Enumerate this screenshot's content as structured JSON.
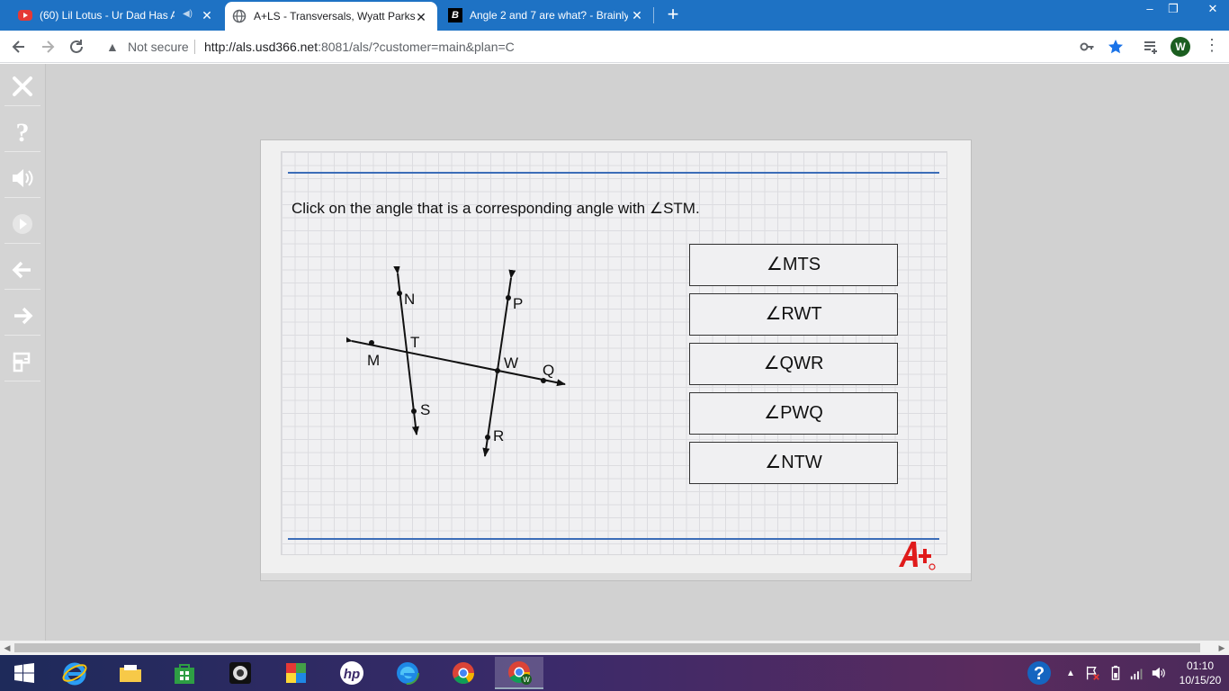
{
  "browser": {
    "tabs": [
      {
        "title": "(60) Lil Lotus - Ur Dad Has A",
        "favicon": "youtube-icon",
        "active": false
      },
      {
        "title": "A+LS - Transversals, Wyatt Parks",
        "favicon": "globe-icon",
        "active": true
      },
      {
        "title": "Angle 2 and 7 are what? - Brainly",
        "favicon": "brainly-icon",
        "active": false
      }
    ],
    "new_tab": "+",
    "security_label": "Not secure",
    "url_host": "http://als.usd366.net",
    "url_rest": ":8081/als/?customer=main&plan=C",
    "profile_initial": "W",
    "window_controls": {
      "minimize": "–",
      "restore": "❐",
      "close": "✕"
    }
  },
  "sidebar": {
    "buttons": [
      "close-icon",
      "help-icon",
      "speaker-icon",
      "play-icon",
      "back-arrow-icon",
      "forward-arrow-icon",
      "tools-icon"
    ]
  },
  "lesson": {
    "prompt": "Click on the angle that is a corresponding angle with ∠STM.",
    "diagram_labels": {
      "N": "N",
      "T": "T",
      "M": "M",
      "S": "S",
      "P": "P",
      "W": "W",
      "Q": "Q",
      "R": "R"
    },
    "answers": [
      "∠MTS",
      "∠RWT",
      "∠QWR",
      "∠PWQ",
      "∠NTW"
    ]
  },
  "taskbar": {
    "apps": [
      "windows-start-icon",
      "internet-explorer-icon",
      "file-explorer-icon",
      "store-icon",
      "camera-app-icon",
      "puzzle-app-icon",
      "hp-icon",
      "edge-icon",
      "chrome-icon",
      "chrome-profile-icon"
    ],
    "time": "01:10",
    "date": "10/15/20"
  },
  "colors": {
    "tabstrip": "#1e72c4",
    "rule_blue": "#3c6db8",
    "logo_red": "#e01b1b",
    "star_blue": "#1a73e8"
  }
}
